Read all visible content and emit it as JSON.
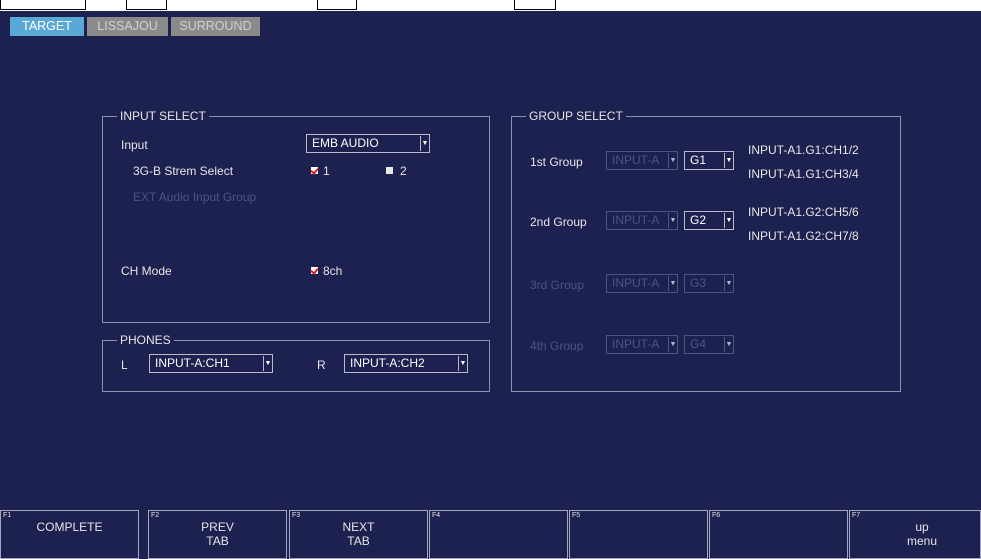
{
  "tabs": [
    "TARGET",
    "LISSAJOU",
    "SURROUND"
  ],
  "input_select": {
    "legend": "INPUT SELECT",
    "input_label": "Input",
    "input_value": "EMB AUDIO",
    "strem_label": "3G-B Strem Select",
    "strem_opt1": "1",
    "strem_opt2": "2",
    "ext_label": "EXT Audio Input Group",
    "ch_mode_label": "CH Mode",
    "ch_mode_value": "8ch"
  },
  "phones": {
    "legend": "PHONES",
    "l_label": "L",
    "l_value": "INPUT-A:CH1",
    "r_label": "R",
    "r_value": "INPUT-A:CH2"
  },
  "group_select": {
    "legend": "GROUP SELECT",
    "groups": [
      {
        "label": "1st Group",
        "input": "INPUT-A",
        "group": "G1",
        "info": [
          "INPUT-A1.G1:CH1/2",
          "INPUT-A1.G1:CH3/4"
        ]
      },
      {
        "label": "2nd Group",
        "input": "INPUT-A",
        "group": "G2",
        "info": [
          "INPUT-A1.G2:CH5/6",
          "INPUT-A1.G2:CH7/8"
        ]
      },
      {
        "label": "3rd Group",
        "input": "INPUT-A",
        "group": "G3",
        "info": []
      },
      {
        "label": "4th Group",
        "input": "INPUT-A",
        "group": "G4",
        "info": []
      }
    ]
  },
  "fkeys": [
    {
      "fn": "F1",
      "line1": "COMPLETE",
      "line2": ""
    },
    {
      "fn": "F2",
      "line1": "PREV",
      "line2": "TAB"
    },
    {
      "fn": "F3",
      "line1": "NEXT",
      "line2": "TAB"
    },
    {
      "fn": "F4",
      "line1": "",
      "line2": ""
    },
    {
      "fn": "F5",
      "line1": "",
      "line2": ""
    },
    {
      "fn": "F6",
      "line1": "",
      "line2": ""
    },
    {
      "fn": "F7",
      "line1": "up",
      "line2": "menu"
    }
  ],
  "colors": {
    "background": "#1c2150",
    "active_tab": "#5aa8d6",
    "inactive_tab": "#8a8a8a",
    "check_mark": "#d21f1f"
  }
}
